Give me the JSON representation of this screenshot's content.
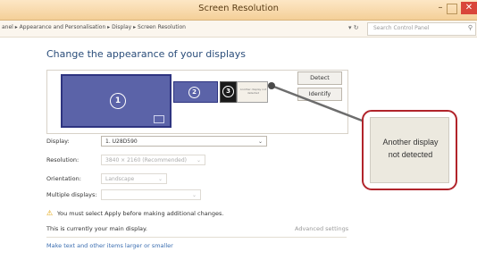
{
  "window": {
    "title": "Screen Resolution",
    "minimize": "–",
    "maximize": "",
    "close": "✕"
  },
  "address": {
    "breadcrumb": "anel  ▸  Appearance and Personalisation  ▸  Display  ▸  Screen Resolution",
    "refresh_icon": "▾ ↻",
    "search_placeholder": "Search Control Panel",
    "search_icon": "⚲"
  },
  "main": {
    "heading": "Change the appearance of your displays",
    "monitors": [
      {
        "number": "1"
      },
      {
        "number": "2"
      },
      {
        "number": "3"
      },
      {
        "label": "Another display not detected"
      }
    ],
    "detect_label": "Detect",
    "identify_label": "Identify",
    "display_label": "Display:",
    "display_value": "1. U28D590",
    "resolution_label": "Resolution:",
    "resolution_value": "3840 × 2160 (Recommended)",
    "orientation_label": "Orientation:",
    "orientation_value": "Landscape",
    "multiple_label": "Multiple displays:",
    "multiple_value": "",
    "dropdown_arrow": "⌄",
    "warning_icon": "⚠",
    "warning_text": "You must select Apply before making additional changes.",
    "main_display_text": "This is currently your main display.",
    "advanced_link": "Advanced settings",
    "text_size_link": "Make text and other items larger or smaller"
  },
  "callout": {
    "line1": "Another display",
    "line2": "not detected"
  }
}
